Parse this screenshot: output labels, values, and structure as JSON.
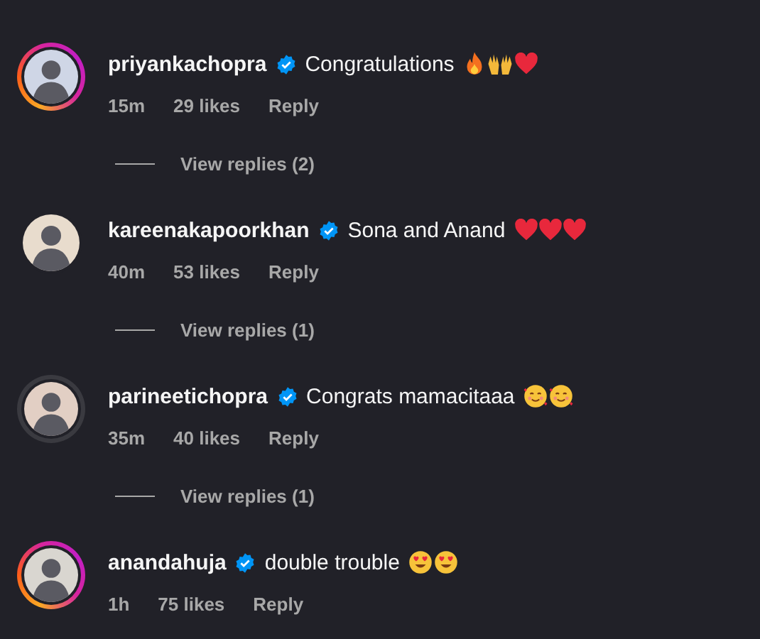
{
  "comments": [
    {
      "username": "priyankachopra",
      "verified": true,
      "has_story": true,
      "story_seen": false,
      "text": "Congratulations",
      "emojis": [
        {
          "kind": "fire"
        },
        {
          "kind": "raised-hands"
        },
        {
          "kind": "heart"
        }
      ],
      "time": "15m",
      "likes": "29 likes",
      "reply": "Reply",
      "view_replies": "View replies (2)"
    },
    {
      "username": "kareenakapoorkhan",
      "verified": true,
      "has_story": false,
      "text": "Sona and Anand",
      "emojis": [
        {
          "kind": "heart"
        },
        {
          "kind": "heart"
        },
        {
          "kind": "heart"
        }
      ],
      "time": "40m",
      "likes": "53 likes",
      "reply": "Reply",
      "view_replies": "View replies (1)"
    },
    {
      "username": "parineetichopra",
      "verified": true,
      "has_story": true,
      "story_seen": true,
      "text": "Congrats mamacitaaa",
      "emojis": [
        {
          "kind": "smiling-hearts"
        },
        {
          "kind": "smiling-hearts"
        }
      ],
      "time": "35m",
      "likes": "40 likes",
      "reply": "Reply",
      "view_replies": "View replies (1)"
    },
    {
      "username": "anandahuja",
      "verified": true,
      "has_story": true,
      "story_seen": false,
      "text": "double trouble",
      "emojis": [
        {
          "kind": "heart-eyes"
        },
        {
          "kind": "heart-eyes"
        }
      ],
      "time": "1h",
      "likes": "75 likes",
      "reply": "Reply"
    }
  ]
}
